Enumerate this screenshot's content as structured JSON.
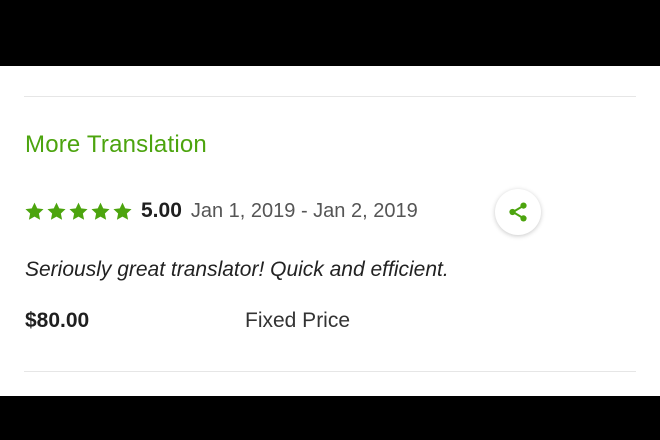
{
  "colors": {
    "accent": "#4ca40e",
    "star": "#4ca40e",
    "text_dark": "#1f1f1f",
    "text_muted": "#555555"
  },
  "job": {
    "title": "More Translation",
    "rating": {
      "stars": 5,
      "max_stars": 5,
      "score": "5.00"
    },
    "date_range": "Jan 1, 2019 - Jan 2, 2019",
    "review": "Seriously great translator! Quick and efficient.",
    "price": "$80.00",
    "price_type": "Fixed Price",
    "share_icon": "share-icon"
  }
}
